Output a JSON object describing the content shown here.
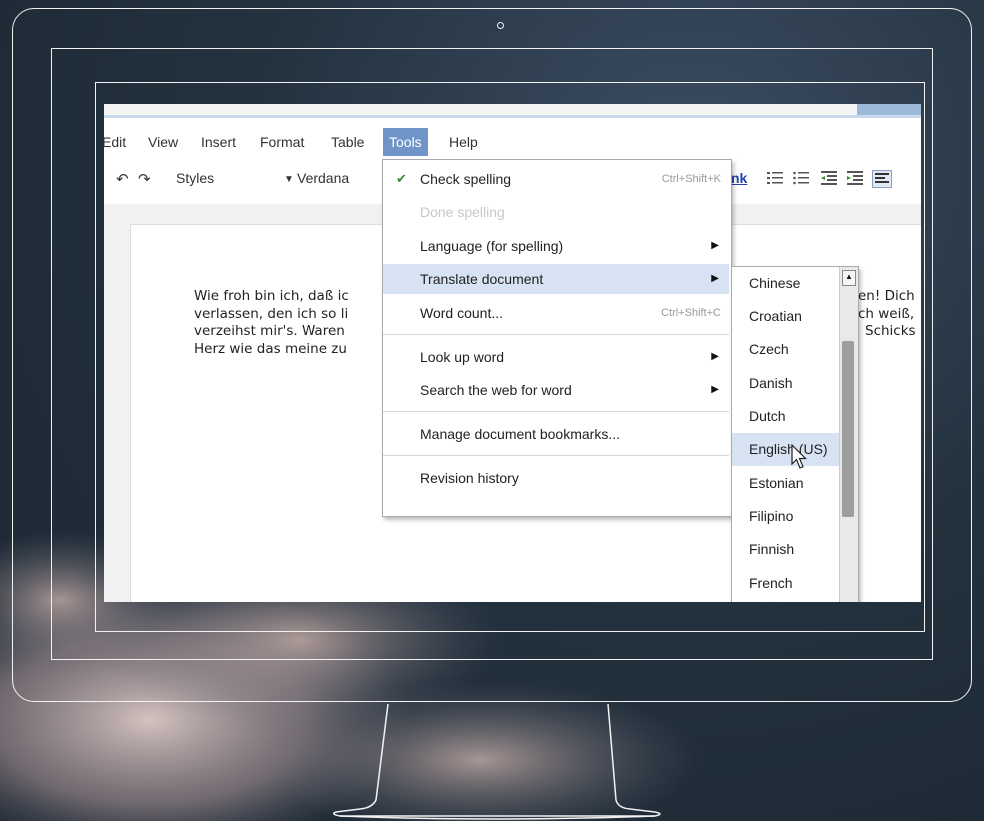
{
  "menubar": {
    "items": [
      {
        "label": "Edit",
        "visible_label": "Edit"
      },
      {
        "label": "View"
      },
      {
        "label": "Insert"
      },
      {
        "label": "Format"
      },
      {
        "label": "Table"
      },
      {
        "label": "Tools"
      },
      {
        "label": "Help"
      }
    ]
  },
  "toolbar": {
    "styles_label": "Styles",
    "font_label": "Verdana",
    "link_label": "nk"
  },
  "document": {
    "lines": [
      "Wie froh bin ich, daß ic",
      "verlassen, den ich so li",
      "verzeihst mir's. Waren",
      "Herz wie das meine zu"
    ],
    "right_fragments": [
      "en! Dich",
      "ch weiß,",
      "Schicks"
    ]
  },
  "tools_menu": {
    "check_spelling": {
      "label": "Check spelling",
      "shortcut": "Ctrl+Shift+K"
    },
    "done_spelling": {
      "label": "Done spelling"
    },
    "language": {
      "label": "Language (for spelling)"
    },
    "translate": {
      "label": "Translate document"
    },
    "word_count": {
      "label": "Word count...",
      "shortcut": "Ctrl+Shift+C"
    },
    "look_up": {
      "label": "Look up word"
    },
    "search_web": {
      "label": "Search the web for word"
    },
    "bookmarks": {
      "label": "Manage document bookmarks..."
    },
    "revision": {
      "label": "Revision history"
    }
  },
  "language_menu": {
    "items": [
      "Chinese",
      "Croatian",
      "Czech",
      "Danish",
      "Dutch",
      "English (US)",
      "Estonian",
      "Filipino",
      "Finnish",
      "French"
    ],
    "selected": "English (US)"
  },
  "icons": {
    "undo": "undo-icon",
    "redo": "redo-icon",
    "spell": "spell-check-icon"
  },
  "colors": {
    "menu_active": "#6f95c8",
    "menu_highlight": "#d7e3f3"
  }
}
